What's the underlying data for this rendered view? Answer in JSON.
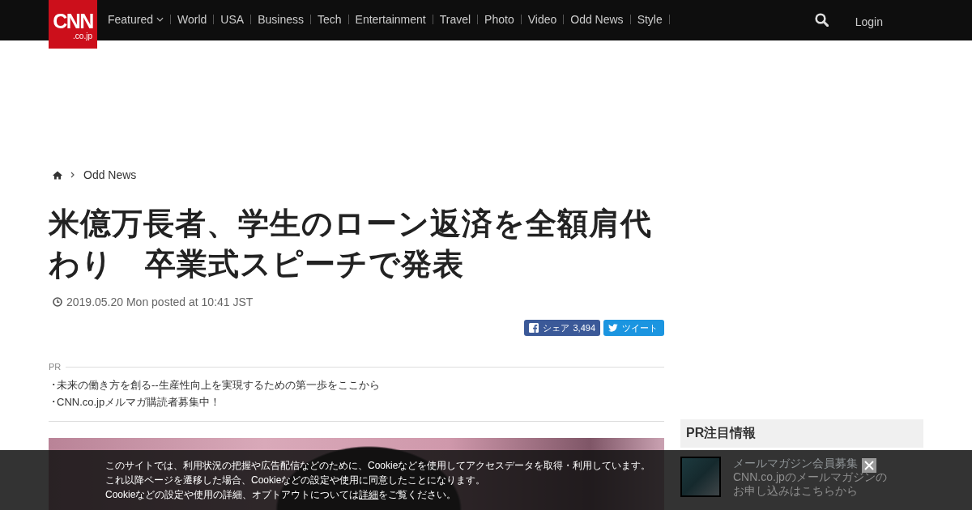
{
  "header": {
    "logo": {
      "name": "CNN",
      "domain": ".co.jp"
    },
    "nav": [
      {
        "label": "Featured",
        "has_menu": true
      },
      {
        "label": "World",
        "has_menu": false
      },
      {
        "label": "USA",
        "has_menu": false
      },
      {
        "label": "Business",
        "has_menu": false
      },
      {
        "label": "Tech",
        "has_menu": false
      },
      {
        "label": "Entertainment",
        "has_menu": false
      },
      {
        "label": "Travel",
        "has_menu": false
      },
      {
        "label": "Photo",
        "has_menu": false
      },
      {
        "label": "Video",
        "has_menu": false
      },
      {
        "label": "Odd News",
        "has_menu": false
      },
      {
        "label": "Style",
        "has_menu": false
      }
    ],
    "login": "Login"
  },
  "breadcrumb": {
    "current": "Odd News"
  },
  "article": {
    "title": "米億万長者、学生のローン返済を全額肩代わり　卒業式スピーチで発表",
    "date": "2019.05.20 Mon posted at 10:41 JST",
    "share_buttons": [
      {
        "kind": "facebook",
        "label": "シェア",
        "count": "3,494"
      },
      {
        "kind": "twitter",
        "label": "ツイート"
      }
    ]
  },
  "pr": {
    "label": "PR",
    "items": [
      "･未来の働き方を創る--生産性向上を実現するための第一歩をここから",
      "･CNN.co.jpメルマガ購読者募集中！"
    ]
  },
  "sidebar": {
    "title": "PR注目情報",
    "items": [
      {
        "title": "メールマガジン会員募集",
        "description": "CNN.co.jpのメールマガジンのお申し込みはこちらから"
      }
    ]
  },
  "cookie_notice": {
    "lines": [
      "このサイトでは、利用状況の把握や広告配信などのために、Cookieなどを使用してアクセスデータを取得・利用しています。",
      "これ以降ページを遷移した場合、Cookieなどの設定や使用に同意したことになります。"
    ],
    "last_line": {
      "before": "Cookieなどの設定や使用の詳細、オプトアウトについては",
      "link": "詳細",
      "after": "をご覧ください。"
    }
  }
}
